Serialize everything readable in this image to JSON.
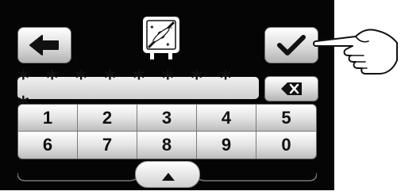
{
  "password": {
    "masked": "* * * * * * * * *"
  },
  "keypad": {
    "keys": [
      "1",
      "2",
      "3",
      "4",
      "5",
      "6",
      "7",
      "8",
      "9",
      "0"
    ]
  },
  "icons": {
    "back": "arrow-left-icon",
    "confirm": "checkmark-icon",
    "delete": "backspace-icon",
    "expand": "triangle-up-icon",
    "device": "fan-device-icon",
    "pointer": "pointing-hand-icon"
  }
}
